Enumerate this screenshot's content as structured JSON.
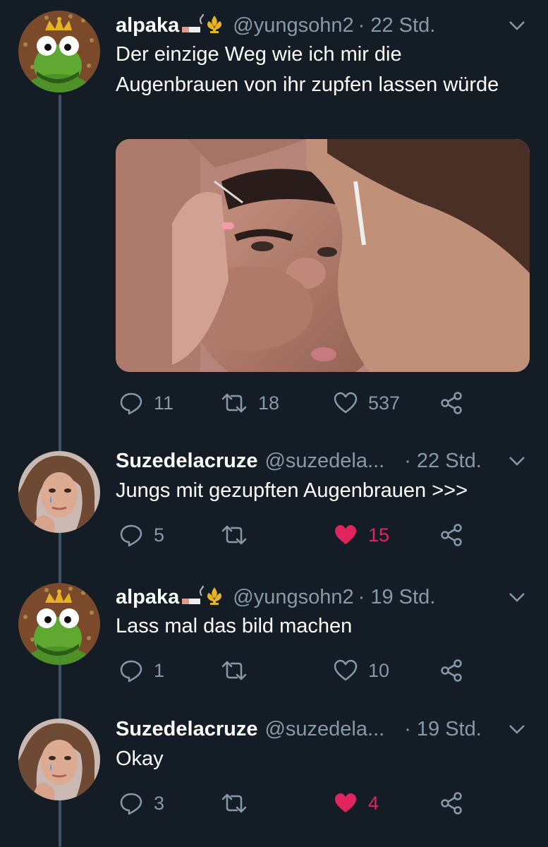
{
  "tweets": [
    {
      "author": "alpaka",
      "handle": "@yungsohn2",
      "time": "· 22 Std.",
      "text": "Der einzige Weg wie ich mir die Augenbrauen von ihr zupfen lassen würde",
      "avatar": "kermit-crown-avatar",
      "replies": "11",
      "retweets": "18",
      "likes": "537",
      "liked": false,
      "has_media": true
    },
    {
      "author": "Suzedelacruze",
      "handle": "@suzedela...",
      "time": "· 22 Std.",
      "text": "Jungs mit gezupften Augenbrauen >>>",
      "avatar": "girl-teardrop-avatar",
      "replies": "5",
      "retweets": "",
      "likes": "15",
      "liked": true
    },
    {
      "author": "alpaka",
      "handle": "@yungsohn2",
      "time": "· 19 Std.",
      "text": "Lass mal das bild machen",
      "avatar": "kermit-crown-avatar",
      "replies": "1",
      "retweets": "",
      "likes": "10",
      "liked": false
    },
    {
      "author": "Suzedelacruze",
      "handle": "@suzedela...",
      "time": "· 19 Std.",
      "text": "Okay",
      "avatar": "girl-teardrop-avatar",
      "replies": "3",
      "retweets": "",
      "likes": "4",
      "liked": true
    }
  ],
  "icons": {
    "reply": "speech-bubble-icon",
    "retweet": "retweet-arrows-icon",
    "like": "heart-icon",
    "share": "share-nodes-icon",
    "menu": "chevron-down-icon",
    "name_emoji": "cigarette-fleur-de-lis-emoji"
  },
  "colors": {
    "background": "#141d26",
    "secondary_text": "#8899a6",
    "like_active": "#e0245e",
    "thread_line": "#3d5466"
  }
}
